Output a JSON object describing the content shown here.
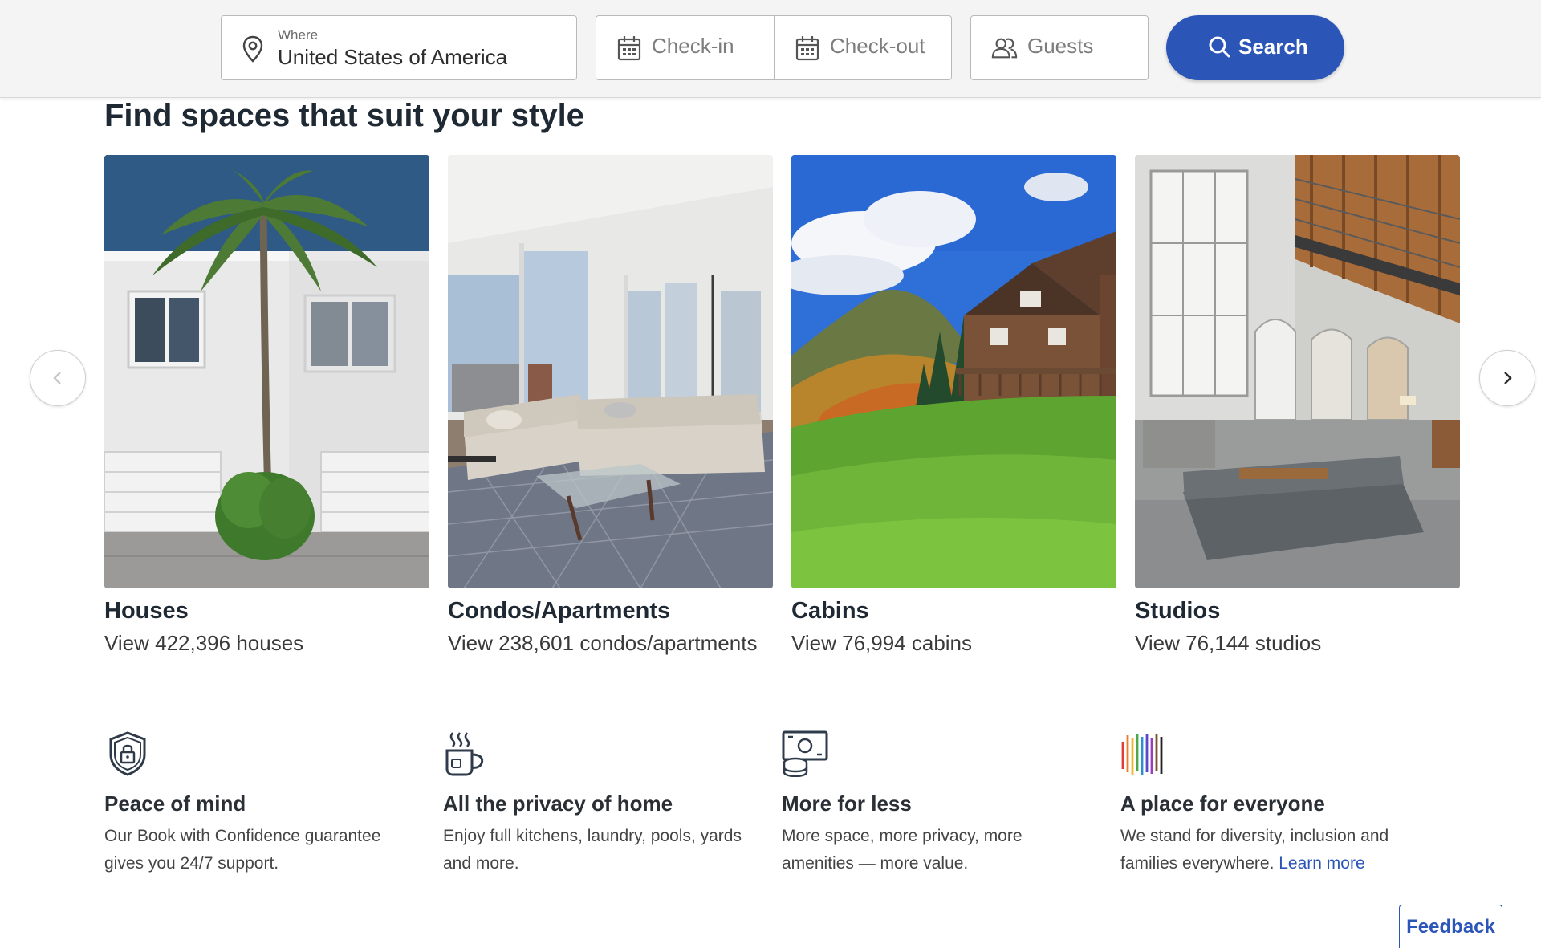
{
  "search": {
    "where_label": "Where",
    "where_value": "United States of America",
    "checkin_placeholder": "Check-in",
    "checkout_placeholder": "Check-out",
    "guests_placeholder": "Guests",
    "button_label": "Search",
    "icons": [
      "map-pin-icon",
      "calendar-icon",
      "calendar-icon",
      "guests-icon",
      "search-icon"
    ]
  },
  "heading": "Find spaces that suit your style",
  "cards": [
    {
      "title": "Houses",
      "subtitle": "View 422,396 houses",
      "image": "white-house-palm-tree"
    },
    {
      "title": "Condos/Apartments",
      "subtitle": "View 238,601 condos/apartments",
      "image": "apartment-living-room"
    },
    {
      "title": "Cabins",
      "subtitle": "View 76,994 cabins",
      "image": "cabin-on-green-hill"
    },
    {
      "title": "Studios",
      "subtitle": "View 76,144 studios",
      "image": "loft-studio-interior"
    }
  ],
  "carousel": {
    "prev_icon": "chevron-left-icon",
    "next_icon": "chevron-right-icon"
  },
  "features": [
    {
      "icon": "shield-lock-icon",
      "title": "Peace of mind",
      "description": "Our Book with Confidence guarantee gives you 24/7 support."
    },
    {
      "icon": "steaming-mug-icon",
      "title": "All the privacy of home",
      "description": "Enjoy full kitchens, laundry, pools, yards and more."
    },
    {
      "icon": "money-coins-icon",
      "title": "More for less",
      "description": "More space, more privacy, more amenities — more value."
    },
    {
      "icon": "rainbow-bars-icon",
      "title": "A place for everyone",
      "description": "We stand for diversity, inclusion and families everywhere.",
      "link": "Learn more"
    }
  ],
  "feedback_label": "Feedback",
  "colors": {
    "primary": "#2c55b8",
    "text": "#1f2933",
    "header_bg": "#f4f4f4"
  }
}
